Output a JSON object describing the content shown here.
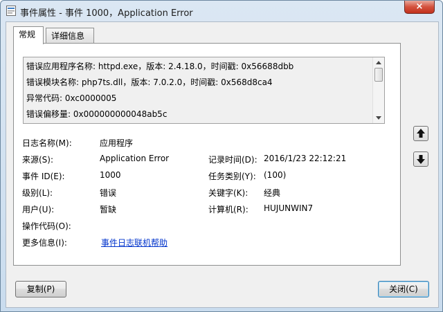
{
  "window": {
    "title": "事件属性 - 事件 1000，Application Error",
    "close_label": "×"
  },
  "tabs": [
    "常规",
    "详细信息"
  ],
  "description_lines": [
    "错误应用程序名称: httpd.exe，版本: 2.4.18.0，时间戳: 0x56688dbb",
    "错误模块名称: php7ts.dll，版本: 7.0.2.0，时间戳: 0x568d8ca4",
    "异常代码: 0xc0000005",
    "错误偏移量: 0x000000000048ab5c"
  ],
  "fields": {
    "log_name": {
      "label": "日志名称(M):",
      "value": "应用程序"
    },
    "source": {
      "label": "来源(S):",
      "value": "Application Error"
    },
    "logged": {
      "label": "记录时间(D):",
      "value": "2016/1/23 22:12:21"
    },
    "event_id": {
      "label": "事件 ID(E):",
      "value": "1000"
    },
    "task_category": {
      "label": "任务类别(Y):",
      "value": "(100)"
    },
    "level": {
      "label": "级别(L):",
      "value": "错误"
    },
    "keywords": {
      "label": "关键字(K):",
      "value": "经典"
    },
    "user": {
      "label": "用户(U):",
      "value": "暂缺"
    },
    "computer": {
      "label": "计算机(R):",
      "value": "HUJUNWIN7"
    },
    "opcode": {
      "label": "操作代码(O):",
      "value": ""
    },
    "more_info": {
      "label": "更多信息(I):",
      "value": "事件日志联机帮助"
    }
  },
  "buttons": {
    "copy": "复制(P)",
    "close": "关闭(C)"
  },
  "icons": {
    "up": "arrow-up-icon",
    "down": "arrow-down-icon"
  }
}
